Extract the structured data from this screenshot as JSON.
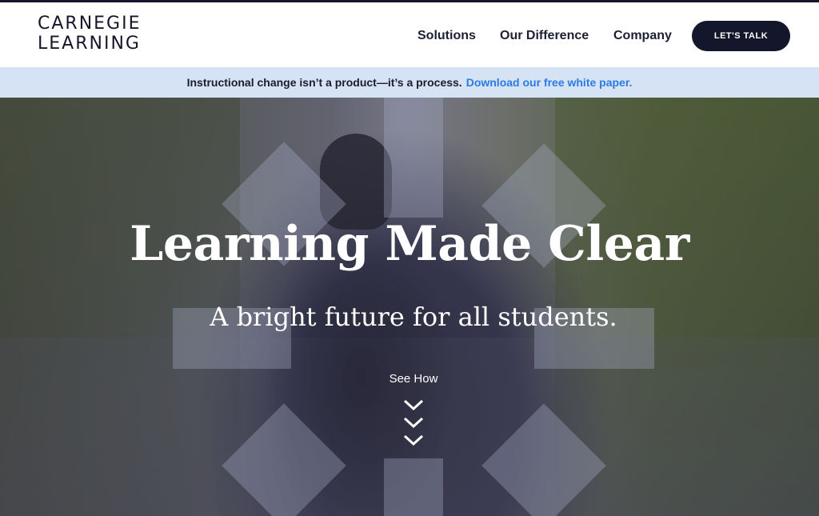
{
  "header": {
    "logo_line1": "CARNEGIE",
    "logo_line2": "LEARNING",
    "nav": [
      "Solutions",
      "Our Difference",
      "Company"
    ],
    "cta_label": "LET'S TALK"
  },
  "banner": {
    "text": "Instructional change isn’t a product—it’s a process.",
    "link": "Download our free white paper."
  },
  "hero": {
    "headline": "Learning Made Clear",
    "subheadline": "A bright future for all students.",
    "see_how": "See How",
    "scroll_icon": "triple-chevron-down-icon"
  },
  "colors": {
    "navy": "#14162b",
    "banner_bg": "#d5e3f4",
    "link_blue": "#2c7be5"
  }
}
